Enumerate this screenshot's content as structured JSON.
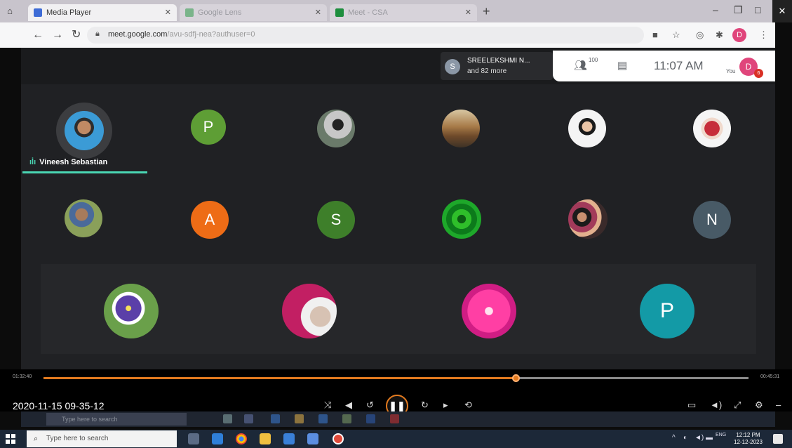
{
  "browser": {
    "tabs": [
      {
        "label": "Media Player",
        "active": true
      },
      {
        "label": "Google Lens",
        "active": false
      },
      {
        "label": "Meet - CSA",
        "active": false
      }
    ],
    "url_host": "meet.google.com",
    "url_path": "/avu-sdfj-nea?authuser=0",
    "profile_initial": "D"
  },
  "meet": {
    "presenter_initial": "S",
    "presenter_name": "SREELEKSHMI N...",
    "presenter_more": "and 82 more",
    "participant_count": "100",
    "clock": "11:07 AM",
    "you_label": "You",
    "you_initial": "D",
    "badge": "6",
    "active_speaker": "Vineesh Sebastian",
    "letters": {
      "p1": "P",
      "a": "A",
      "s": "S",
      "n": "N",
      "p2": "P"
    }
  },
  "player": {
    "elapsed": "01:32:40",
    "total": "00:45:31",
    "progress": 0.67,
    "timestamp": "2020-11-15 09-35-12"
  },
  "inner_taskbar": {
    "search_placeholder": "Type here to search"
  },
  "taskbar": {
    "search_placeholder": "Type here to search",
    "time": "12:12 PM",
    "date": "12-12-2023",
    "lang": "ENG"
  },
  "colors": {
    "accent": "#e27a1f",
    "speaking": "#4ad6b3",
    "meet_bg": "#202124"
  }
}
